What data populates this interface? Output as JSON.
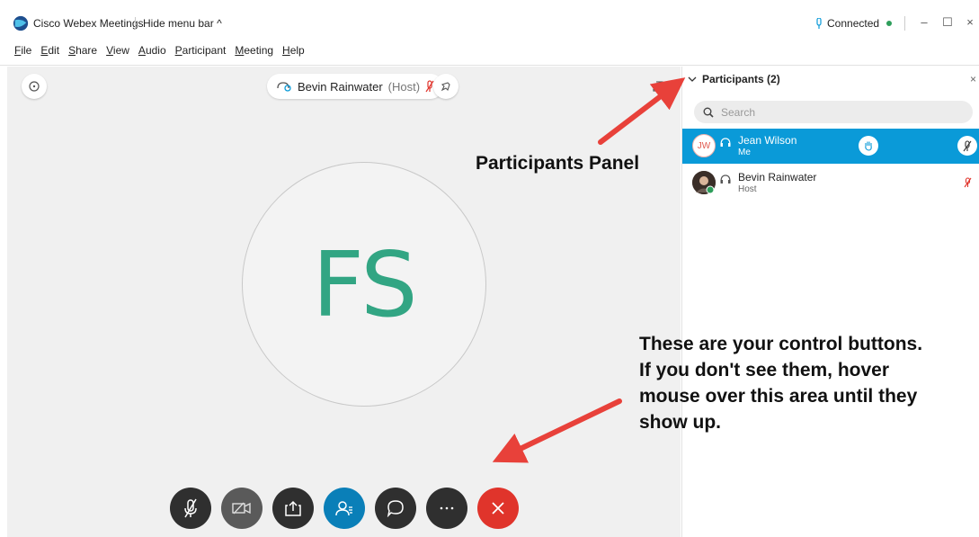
{
  "window": {
    "app_title": "Cisco Webex Meetings",
    "hide_menu_label": "Hide menu bar",
    "hide_menu_chevron": "^",
    "connection_status": "Connected",
    "status_color": "#2e9e5b",
    "min_glyph": "–",
    "max_glyph": "☐",
    "close_glyph": "×"
  },
  "menu": {
    "items": [
      {
        "first": "F",
        "rest": "ile"
      },
      {
        "first": "E",
        "rest": "dit"
      },
      {
        "first": "S",
        "rest": "hare"
      },
      {
        "first": "V",
        "rest": "iew"
      },
      {
        "first": "A",
        "rest": "udio"
      },
      {
        "first": "P",
        "rest": "articipant"
      },
      {
        "first": "M",
        "rest": "eeting"
      },
      {
        "first": "H",
        "rest": "elp"
      }
    ]
  },
  "stage": {
    "active_speaker_name": "Bevin Rainwater",
    "active_speaker_role": "(Host)",
    "avatar_initials": "FS",
    "avatar_color": "#32a583"
  },
  "controls": [
    {
      "name": "mute-button",
      "icon": "mic-off-icon",
      "color": "#2f2f2f"
    },
    {
      "name": "video-button",
      "icon": "video-off-icon",
      "color": "#5a5a5a"
    },
    {
      "name": "share-button",
      "icon": "share-icon",
      "color": "#2f2f2f"
    },
    {
      "name": "participants-button",
      "icon": "participants-icon",
      "color": "#0a7fb8"
    },
    {
      "name": "chat-button",
      "icon": "chat-icon",
      "color": "#2f2f2f"
    },
    {
      "name": "more-button",
      "icon": "more-icon",
      "color": "#2f2f2f"
    },
    {
      "name": "leave-button",
      "icon": "close-icon",
      "color": "#e0342b"
    }
  ],
  "panel": {
    "title": "Participants (2)",
    "close_glyph": "×",
    "search_placeholder": "Search",
    "participants": [
      {
        "initials": "JW",
        "name": "Jean Wilson",
        "subtitle": "Me",
        "selected": true
      },
      {
        "initials": "",
        "name": "Bevin Rainwater",
        "subtitle": "Host",
        "selected": false
      }
    ]
  },
  "annotations": {
    "panel_label": "Participants Panel",
    "controls_line_1": "These are your control buttons.",
    "controls_line_2": "If you don't see them, hover",
    "controls_line_3": "mouse over this area until they",
    "controls_line_4": "show up.",
    "arrow_color": "#e8413a"
  }
}
